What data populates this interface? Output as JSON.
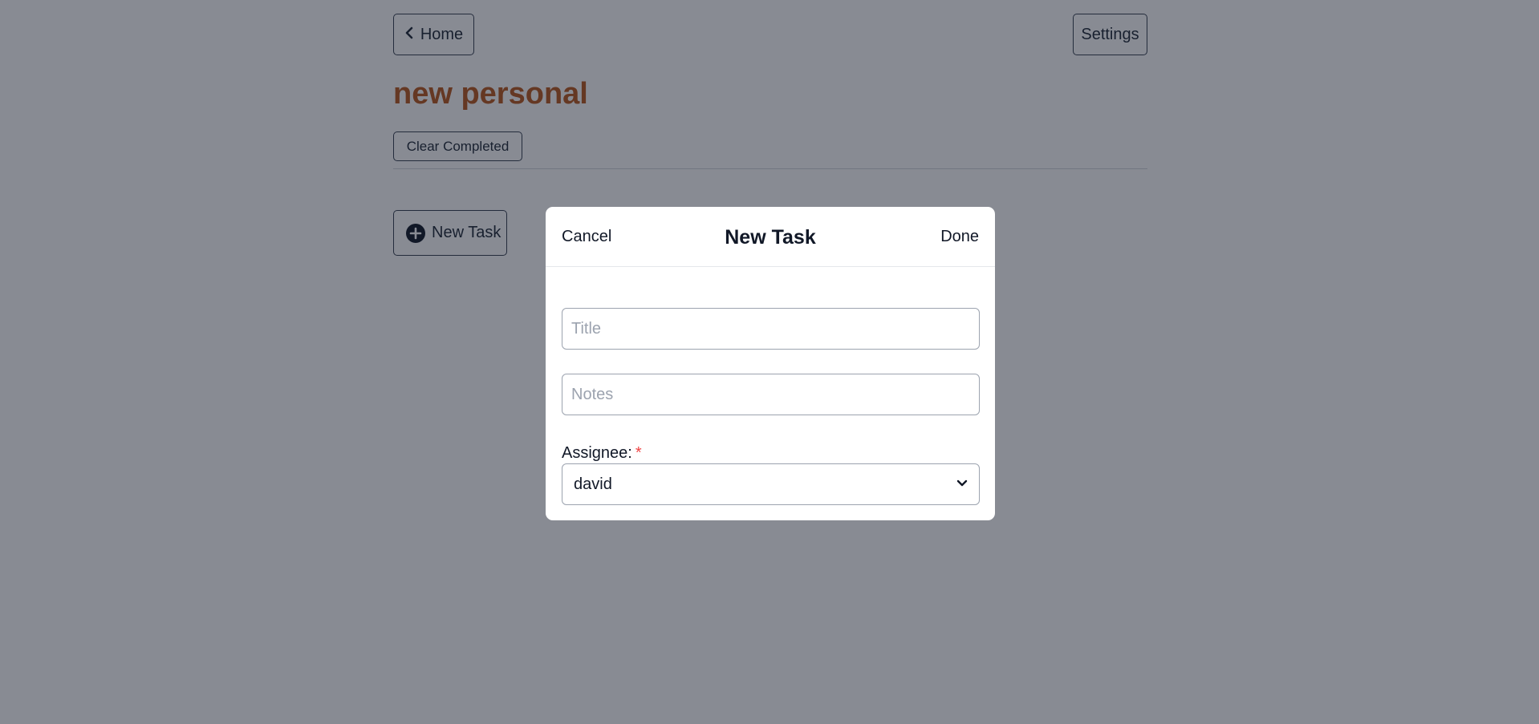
{
  "header": {
    "home_label": "Home",
    "settings_label": "Settings"
  },
  "list": {
    "title": "new personal",
    "title_color": "#b8581f",
    "clear_completed_label": "Clear Completed",
    "new_task_label": "New Task"
  },
  "modal": {
    "title": "New Task",
    "cancel_label": "Cancel",
    "done_label": "Done",
    "title_placeholder": "Title",
    "title_value": "",
    "notes_placeholder": "Notes",
    "notes_value": "",
    "assignee_label": "Assignee:",
    "required_marker": "*",
    "assignee_selected": "david"
  },
  "icons": {
    "back": "chevron-left-icon",
    "new_task": "plus-circle-icon",
    "select": "chevron-down-icon"
  }
}
